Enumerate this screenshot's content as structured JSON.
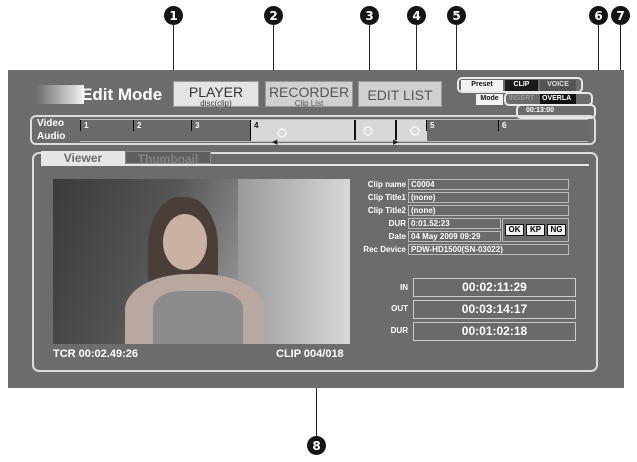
{
  "callouts": [
    "1",
    "2",
    "3",
    "4",
    "5",
    "6",
    "7",
    "8"
  ],
  "header": {
    "mode_title": "Edit Mode",
    "player_label": "PLAYER",
    "player_sub": "disc(clip)",
    "recorder_label": "RECORDER",
    "recorder_sub": "Clip List",
    "editlist_label": "EDIT LIST"
  },
  "preset": {
    "preset_label": "Preset",
    "clip": "CLIP",
    "voice": "VOICE",
    "mode_label": "Mode",
    "insert": "INSERT",
    "overlay": "OVERLA",
    "duration": "00:13:00"
  },
  "timeline": {
    "video_label": "Video",
    "audio_label": "Audio",
    "segments": [
      "1",
      "2",
      "3",
      "4",
      "5",
      "6"
    ]
  },
  "tabs": {
    "viewer": "Viewer",
    "thumbnail": "Thumbnail"
  },
  "clip_info": {
    "clip_name_label": "Clip name",
    "clip_name": "C0004",
    "title1_label": "Clip Title1",
    "title1": "(none)",
    "title2_label": "Clip Title2",
    "title2": "(none)",
    "dur_label": "DUR",
    "dur": "0:01.52:23",
    "date_label": "Date",
    "date": "04 May 2009 09:29",
    "rec_device_label": "Rec Device",
    "rec_device": "PDW-HD1500(SN-03022)"
  },
  "marks": {
    "ok": "OK",
    "kp": "KP",
    "ng": "NG"
  },
  "timecodes": {
    "in_label": "IN",
    "in": "00:02:11:29",
    "out_label": "OUT",
    "out": "00:03:14:17",
    "dur_label": "DUR",
    "dur": "00:01:02:18"
  },
  "footer": {
    "tcr": "TCR 00:02.49:26",
    "clip_counter": "CLIP 004/018"
  },
  "colors": {
    "screen_bg": "#6c6c6c",
    "panel_border": "#dcdcdc",
    "callout": "#151515"
  }
}
